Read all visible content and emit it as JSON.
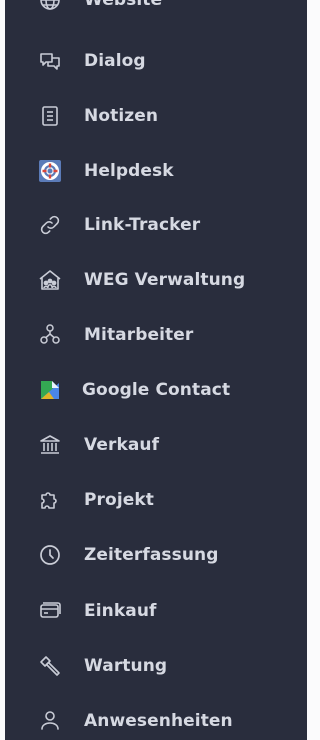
{
  "sidebar": {
    "items": [
      {
        "label": "Website",
        "icon": "globe-icon"
      },
      {
        "label": "Dialog",
        "icon": "chat-bubbles-icon"
      },
      {
        "label": "Notizen",
        "icon": "notes-icon"
      },
      {
        "label": "Helpdesk",
        "icon": "lifebuoy-icon"
      },
      {
        "label": "Link-Tracker",
        "icon": "link-icon"
      },
      {
        "label": "WEG Verwaltung",
        "icon": "house-community-icon"
      },
      {
        "label": "Mitarbeiter",
        "icon": "team-network-icon"
      },
      {
        "label": "Google Contact",
        "icon": "google-contacts-icon"
      },
      {
        "label": "Verkauf",
        "icon": "bank-building-icon"
      },
      {
        "label": "Projekt",
        "icon": "puzzle-icon"
      },
      {
        "label": "Zeiterfassung",
        "icon": "clock-icon"
      },
      {
        "label": "Einkauf",
        "icon": "credit-card-icon"
      },
      {
        "label": "Wartung",
        "icon": "hammer-icon"
      },
      {
        "label": "Anwesenheiten",
        "icon": "user-check-icon"
      }
    ]
  },
  "colors": {
    "sidebar_bg": "#292d3d",
    "text": "#d6d9e2",
    "icon_stroke": "#c9ccd6",
    "page_bg": "#fbfbfc",
    "helpdesk_tile": "#5b7bb8",
    "google_green": "#34a853",
    "google_blue": "#4a86e8"
  }
}
